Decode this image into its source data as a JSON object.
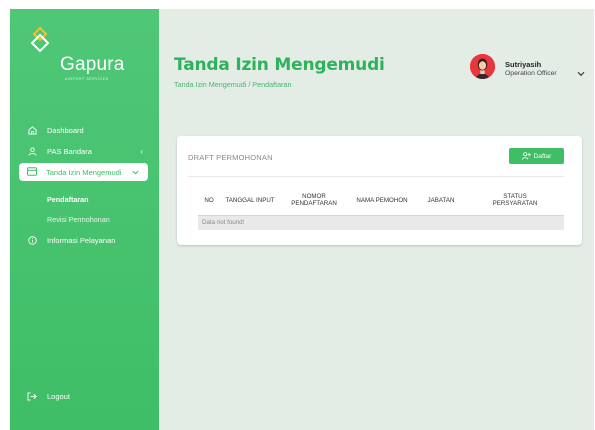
{
  "brand": {
    "name": "Gapura",
    "tagline": "AIRPORT SERVICES"
  },
  "sidebar": {
    "items": [
      {
        "label": "Dashboard",
        "icon": "home-icon"
      },
      {
        "label": "PAS Bandara",
        "icon": "user-icon"
      },
      {
        "label": "Tanda Izin Mengemudi",
        "icon": "card-icon",
        "active": true
      },
      {
        "label": "Informasi Pelayanan",
        "icon": "info-icon"
      }
    ],
    "sub_items": [
      {
        "label": "Pendaftaran",
        "active": true
      },
      {
        "label": "Revisi Permohonan"
      }
    ],
    "logout_label": "Logout"
  },
  "header": {
    "title": "Tanda Izin Mengemudi",
    "breadcrumb": "Tanda Izin Mengemudi / Pendaftaran",
    "user": {
      "name": "Sutriyasih",
      "role": "Operation Officer"
    }
  },
  "card": {
    "title": "DRAFT PERMOHONAN",
    "add_button_label": "Daftar",
    "table": {
      "columns": [
        "NO",
        "TANGGAL INPUT",
        "NOMOR\nPENDAFTARAN",
        "NAMA PEMOHON",
        "JABATAN",
        "STATUS\nPERSYARATAN"
      ],
      "empty_message": "Data not found!"
    }
  },
  "colors": {
    "accent": "#3fbe66",
    "title_green": "#2fb25c",
    "background": "#e4ece6"
  }
}
